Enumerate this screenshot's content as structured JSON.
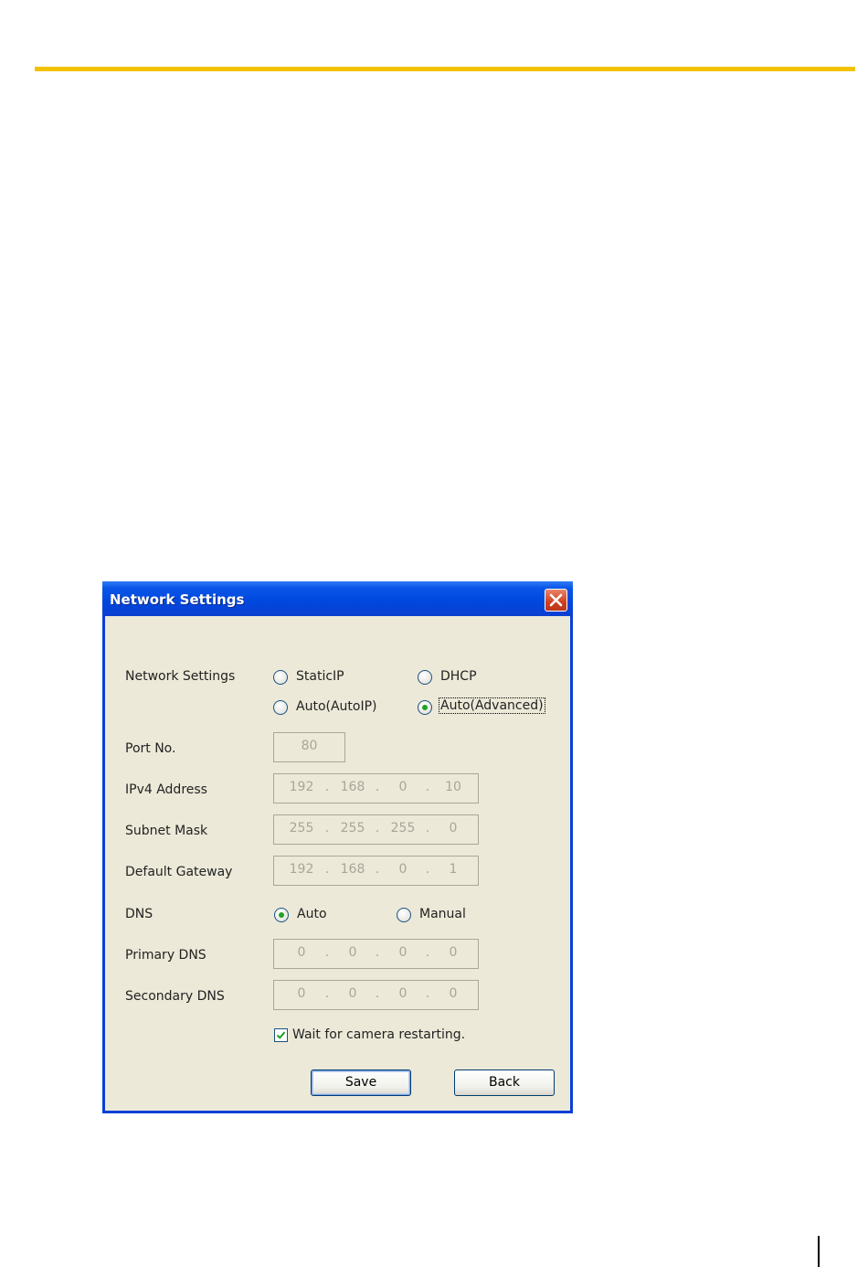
{
  "dialog": {
    "title": "Network Settings",
    "network_settings": {
      "label": "Network Settings",
      "options": [
        "StaticIP",
        "DHCP",
        "Auto(AutoIP)",
        "Auto(Advanced)"
      ],
      "selected": "Auto(Advanced)"
    },
    "port": {
      "label": "Port No.",
      "value": "80"
    },
    "ipv4": {
      "label": "IPv4 Address",
      "octets": [
        "192",
        "168",
        "0",
        "10"
      ]
    },
    "subnet": {
      "label": "Subnet Mask",
      "octets": [
        "255",
        "255",
        "255",
        "0"
      ]
    },
    "gateway": {
      "label": "Default Gateway",
      "octets": [
        "192",
        "168",
        "0",
        "1"
      ]
    },
    "dns": {
      "label": "DNS",
      "options": [
        "Auto",
        "Manual"
      ],
      "selected": "Auto"
    },
    "primary_dns": {
      "label": "Primary DNS",
      "octets": [
        "0",
        "0",
        "0",
        "0"
      ]
    },
    "secondary_dns": {
      "label": "Secondary DNS",
      "octets": [
        "0",
        "0",
        "0",
        "0"
      ]
    },
    "wait_checkbox": {
      "label": "Wait for camera restarting.",
      "checked": true
    },
    "buttons": {
      "save": "Save",
      "back": "Back"
    }
  },
  "colors": {
    "rule": "#f2c200",
    "titlebar": "#0a4fe0",
    "client": "#ece9d8",
    "radio_dot": "#21a121"
  }
}
